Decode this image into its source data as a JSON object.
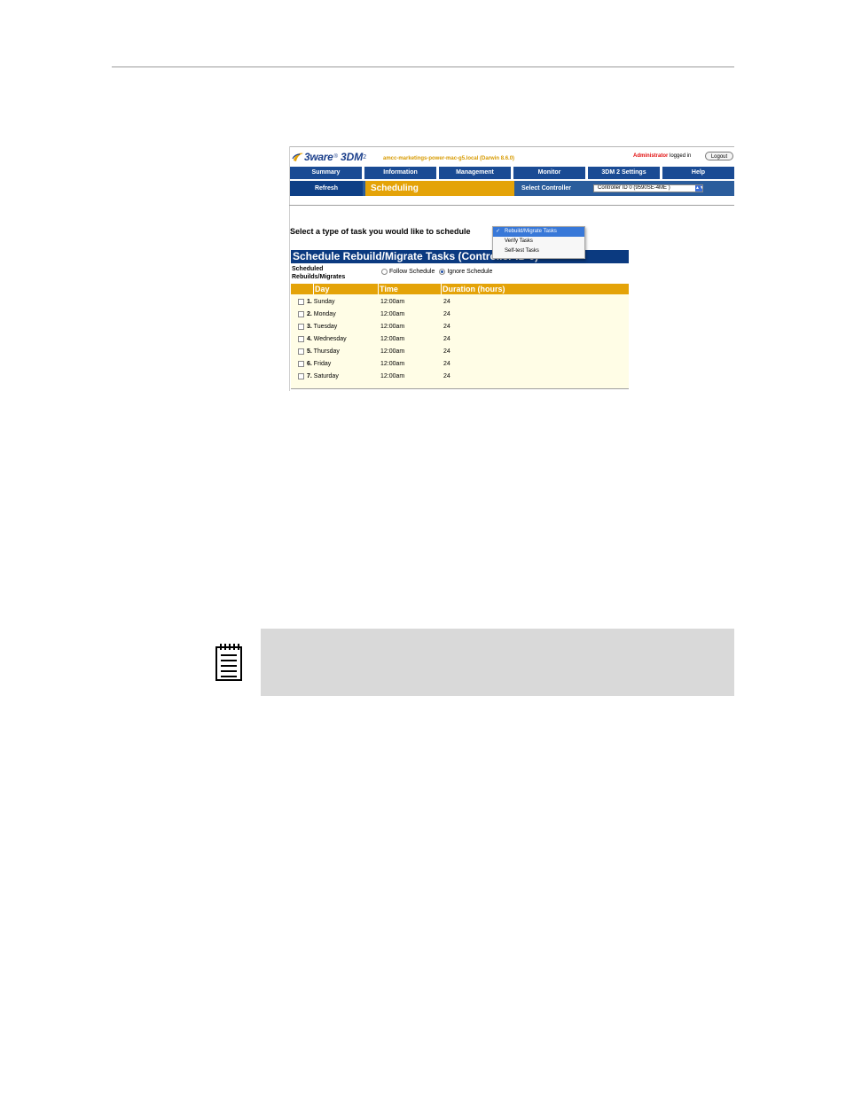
{
  "header": {
    "logo_brand": "3ware",
    "logo_reg": "®",
    "logo_product": "3DM",
    "logo_version": "2",
    "host": "amcc-marketings-power-mac-g5.local (Darwin 8.6.0)",
    "user_role": "Administrator",
    "user_status": "logged in",
    "logout_label": "Logout"
  },
  "nav": {
    "tabs": [
      {
        "label": "Summary"
      },
      {
        "label": "Information"
      },
      {
        "label": "Management"
      },
      {
        "label": "Monitor"
      },
      {
        "label": "3DM 2 Settings"
      },
      {
        "label": "Help"
      }
    ],
    "refresh_label": "Refresh",
    "current_page": "Scheduling",
    "select_controller_label": "Select Controller",
    "controller_value": "Controller ID 0 (9590SE-4ME )"
  },
  "task_prompt": "Select a type of task you would like to schedule",
  "task_dropdown": {
    "options": [
      {
        "label": "Rebuild/Migrate Tasks",
        "selected": true
      },
      {
        "label": "Verify Tasks",
        "selected": false
      },
      {
        "label": "Self-test Tasks",
        "selected": false
      }
    ],
    "check_glyph": "✓"
  },
  "panel": {
    "title": "Schedule Rebuild/Migrate Tasks (Controller ID 0)",
    "option_label_line1": "Scheduled",
    "option_label_line2": "Rebuilds/Migrates",
    "radio_follow": "Follow Schedule",
    "radio_ignore": "Ignore Schedule",
    "selected_radio": "Ignore Schedule"
  },
  "table": {
    "columns": [
      "Day",
      "Time",
      "Duration (hours)"
    ],
    "rows": [
      {
        "num": "1.",
        "day": "Sunday",
        "time": "12:00am",
        "duration": "24"
      },
      {
        "num": "2.",
        "day": "Monday",
        "time": "12:00am",
        "duration": "24"
      },
      {
        "num": "3.",
        "day": "Tuesday",
        "time": "12:00am",
        "duration": "24"
      },
      {
        "num": "4.",
        "day": "Wednesday",
        "time": "12:00am",
        "duration": "24"
      },
      {
        "num": "5.",
        "day": "Thursday",
        "time": "12:00am",
        "duration": "24"
      },
      {
        "num": "6.",
        "day": "Friday",
        "time": "12:00am",
        "duration": "24"
      },
      {
        "num": "7.",
        "day": "Saturday",
        "time": "12:00am",
        "duration": "24"
      }
    ]
  },
  "colors": {
    "nav_blue": "#1a4b94",
    "accent_gold": "#e4a308",
    "title_blue": "#0b3a80",
    "table_bg": "#fffde6",
    "note_bg": "#d9d9d9"
  },
  "icons": {
    "logo": "3ware-swoosh-icon",
    "note": "notepad-icon"
  }
}
